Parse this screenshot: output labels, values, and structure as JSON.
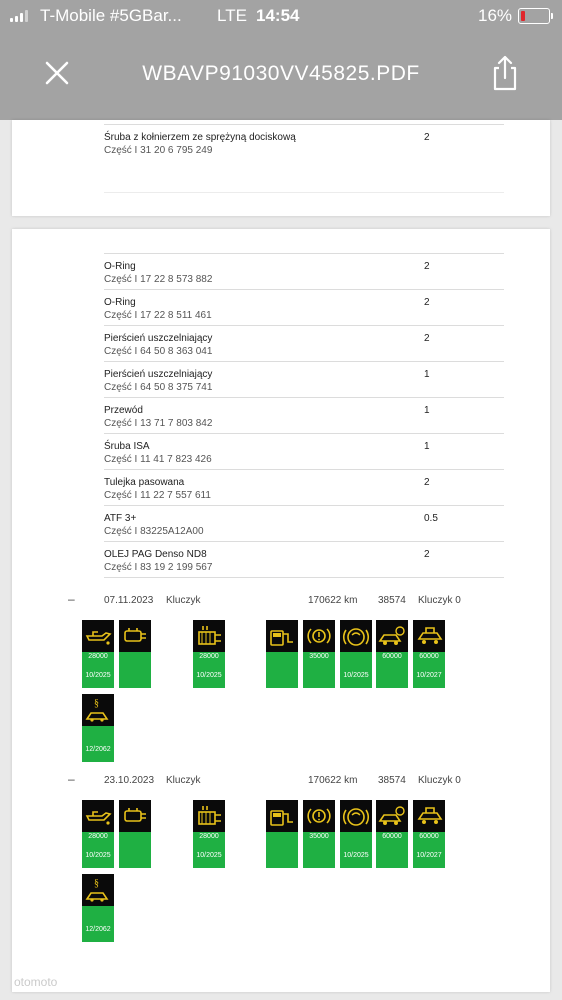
{
  "status_bar": {
    "carrier": "T-Mobile #5GBar...",
    "network": "LTE",
    "time": "14:54",
    "battery_pct": "16%",
    "battery_color": "#e0262b"
  },
  "nav": {
    "title": "WBAVP91030VV45825.PDF",
    "close_icon": "close-icon",
    "share_icon": "share-icon"
  },
  "page1": {
    "parts": [
      {
        "name": "Śruba z kołnierzem ze sprężyną dociskową",
        "part": "Część I 31 20 6 795 249",
        "qty": "2"
      }
    ]
  },
  "page2": {
    "parts": [
      {
        "name": "O-Ring",
        "part": "Część I 17 22 8 573 882",
        "qty": "2"
      },
      {
        "name": "O-Ring",
        "part": "Część I 17 22 8 511 461",
        "qty": "2"
      },
      {
        "name": "Pierścień uszczelniający",
        "part": "Część I 64 50 8 363 041",
        "qty": "2"
      },
      {
        "name": "Pierścień uszczelniający",
        "part": "Część I 64 50 8 375 741",
        "qty": "1"
      },
      {
        "name": "Przewód",
        "part": "Część I 13 71 7 803 842",
        "qty": "1"
      },
      {
        "name": "Śruba ISA",
        "part": "Część I 11 41 7 823 426",
        "qty": "1"
      },
      {
        "name": "Tulejka pasowana",
        "part": "Część I 11 22 7 557 611",
        "qty": "2"
      },
      {
        "name": "ATF 3+",
        "part": "Część I 83225A12A00",
        "qty": "0.5"
      },
      {
        "name": "OLEJ PAG Denso ND8",
        "part": "Część I 83 19 2 199 567",
        "qty": "2"
      }
    ]
  },
  "services": [
    {
      "collapse": "–",
      "date": "07.11.2023",
      "key": "Kluczyk",
      "km": "170622 km",
      "num": "38574",
      "key_id": "Kluczyk 0",
      "tiles": [
        {
          "icon": "oil-icon",
          "v1": "28000",
          "v2": "10/2025"
        },
        {
          "icon": "vehicle-check-icon",
          "v1": "",
          "v2": ""
        },
        {
          "icon": "microfilter-icon",
          "v1": "28000",
          "v2": "10/2025"
        },
        {
          "icon": "fuel-filter-icon",
          "v1": "",
          "v2": ""
        },
        {
          "icon": "front-brake-icon",
          "v1": "35000",
          "v2": ""
        },
        {
          "icon": "brake-fluid-icon",
          "v1": "",
          "v2": "10/2025"
        },
        {
          "icon": "rear-brake-icon",
          "v1": "60000",
          "v2": ""
        },
        {
          "icon": "vehicle-inspection-icon",
          "v1": "60000",
          "v2": "10/2027"
        },
        {
          "icon": "legal-inspection-icon",
          "v1": "",
          "v2": "12/2062"
        }
      ]
    },
    {
      "collapse": "–",
      "date": "23.10.2023",
      "key": "Kluczyk",
      "km": "170622 km",
      "num": "38574",
      "key_id": "Kluczyk 0",
      "tiles": [
        {
          "icon": "oil-icon",
          "v1": "28000",
          "v2": "10/2025"
        },
        {
          "icon": "vehicle-check-icon",
          "v1": "",
          "v2": ""
        },
        {
          "icon": "microfilter-icon",
          "v1": "28000",
          "v2": "10/2025"
        },
        {
          "icon": "fuel-filter-icon",
          "v1": "",
          "v2": ""
        },
        {
          "icon": "front-brake-icon",
          "v1": "35000",
          "v2": ""
        },
        {
          "icon": "brake-fluid-icon",
          "v1": "",
          "v2": "10/2025"
        },
        {
          "icon": "rear-brake-icon",
          "v1": "60000",
          "v2": ""
        },
        {
          "icon": "vehicle-inspection-icon",
          "v1": "60000",
          "v2": "10/2027"
        },
        {
          "icon": "legal-inspection-icon",
          "v1": "",
          "v2": "12/2062"
        }
      ]
    }
  ],
  "watermark": "otomoto"
}
